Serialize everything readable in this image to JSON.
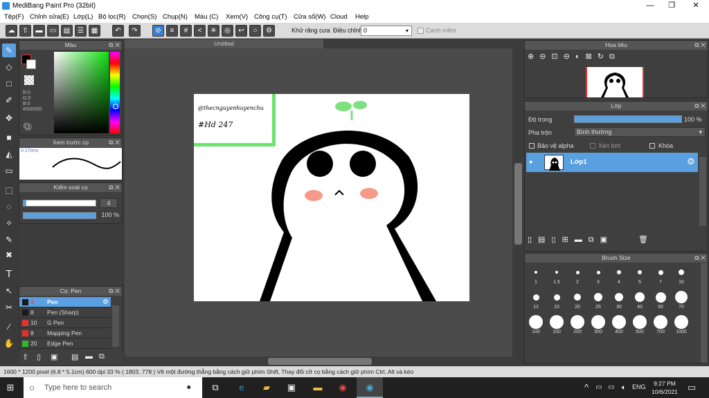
{
  "app": {
    "title": "MediBang Paint Pro (32bit)"
  },
  "menu": [
    "Tệp(F)",
    "Chỉnh sửa(E)",
    "Lớp(L)",
    "Bộ lọc(R)",
    "Chọn(S)",
    "Chụp(N)",
    "Màu (C)",
    "Xem(V)",
    "Công cụ(T)",
    "Cửa sổ(W)",
    "Cloud",
    "Help"
  ],
  "toolbar": {
    "antialias_label": "Khử răng cưa",
    "adjust_label": "Điều chỉnh",
    "adjust_value": "0",
    "snap_label": "Canh mềm"
  },
  "color_panel": {
    "title": "Màu",
    "r": "R:0",
    "g": "G:0",
    "b": "B:0",
    "hex": "#000000"
  },
  "preview_panel": {
    "title": "Xem trước cọ",
    "size": "0.17mm"
  },
  "control_panel": {
    "title": "Kiểm soát cọ",
    "size_value": "4",
    "opacity_value": "100 %"
  },
  "document": {
    "tab": "Untitled"
  },
  "canvas_text": {
    "line1": "@thecnguyenhuyenchu",
    "line2": "#Hd 247"
  },
  "brush_panel": {
    "title": "Cọ: Pen",
    "items": [
      {
        "size": "4",
        "name": "Pen",
        "color": "#1a1a1a"
      },
      {
        "size": "8",
        "name": "Pen (Sharp)",
        "color": "#1a1a1a"
      },
      {
        "size": "10",
        "name": "G Pen",
        "color": "#e53030"
      },
      {
        "size": "8",
        "name": "Mapping Pen",
        "color": "#e53030"
      },
      {
        "size": "20",
        "name": "Edge Pen",
        "color": "#2eb82e"
      }
    ]
  },
  "navigator": {
    "title": "Hoa tiêu"
  },
  "layer_panel": {
    "title": "Lớp",
    "opacity_label": "Độ trong",
    "opacity_value": "100 %",
    "blend_label": "Pha trộn",
    "blend_value": "Bình thường",
    "protect_alpha": "Bảo vệ alpha",
    "clipping": "Xén bớt",
    "lock": "Khóa",
    "layer_name": "Lớp1"
  },
  "brush_size_panel": {
    "title": "Brush Size",
    "sizes": [
      "1",
      "1.5",
      "2",
      "3",
      "4",
      "5",
      "7",
      "10",
      "12",
      "15",
      "20",
      "25",
      "30",
      "40",
      "50",
      "70",
      "100",
      "150",
      "200",
      "300",
      "400",
      "500",
      "700",
      "1000"
    ]
  },
  "status": {
    "text": "1600 * 1200 pixel  (6.8 * 5.1cm)  600 dpi  33 %  ( 1803, 778 )  Vẽ một đường thẳng bằng cách giữ phím Shift, Thay đổi cỡ cọ bằng cách giữ phím Ctrl, Alt và kéo"
  },
  "taskbar": {
    "search_placeholder": "Type here to search",
    "lang": "ENG",
    "time": "9:27 PM",
    "date": "10/6/2021"
  }
}
